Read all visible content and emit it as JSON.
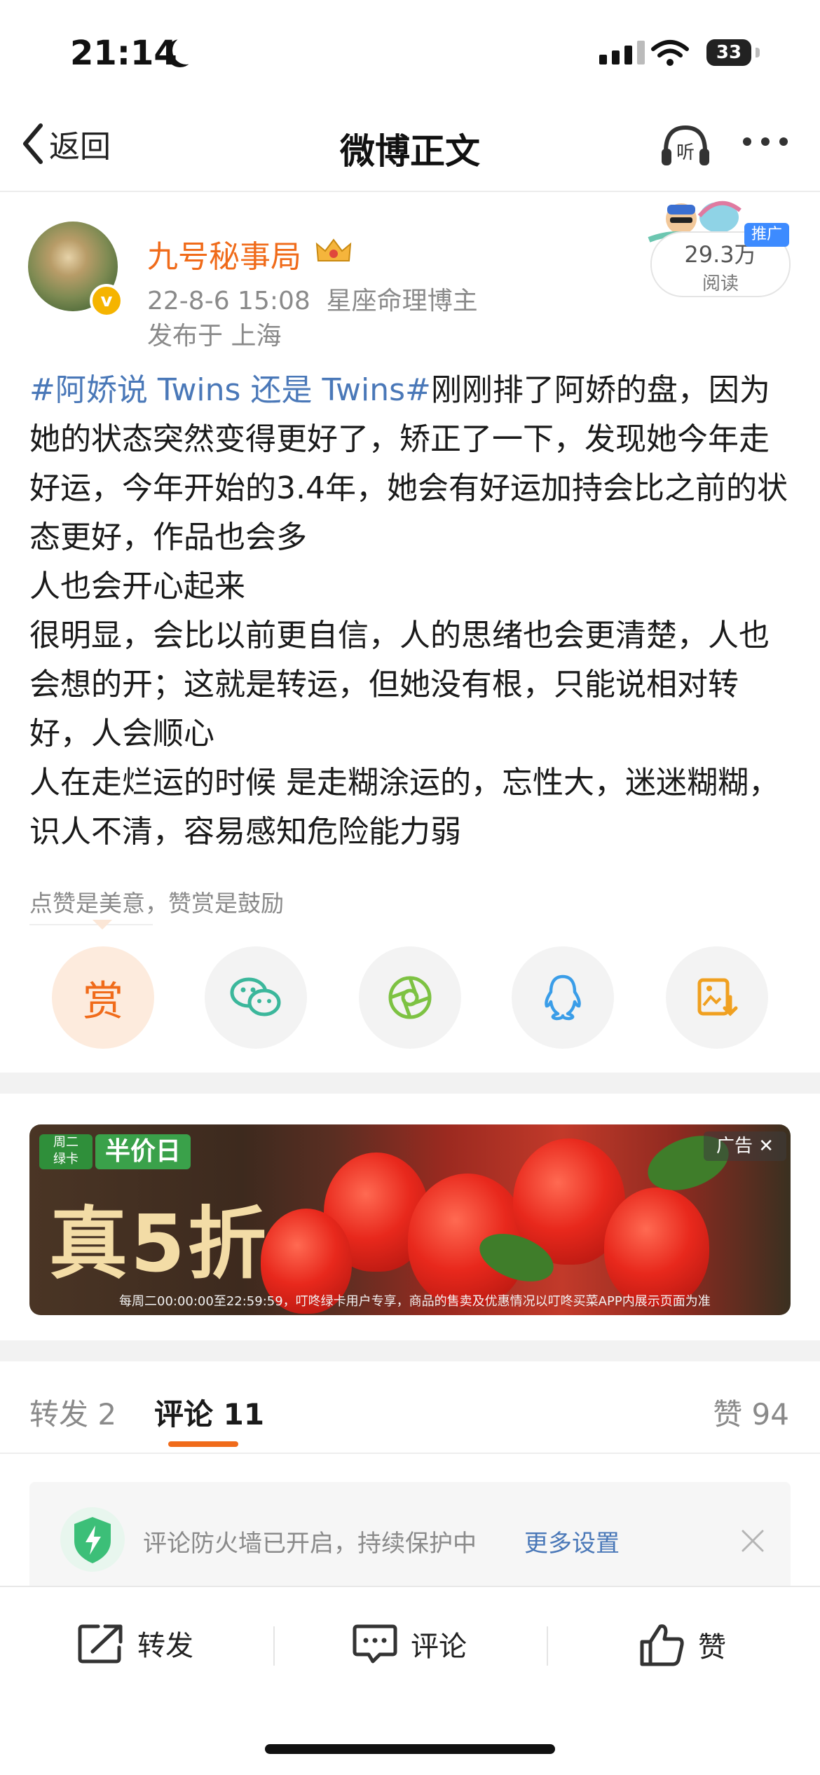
{
  "status_bar": {
    "time": "21:14",
    "battery": "33"
  },
  "nav": {
    "back_label": "返回",
    "title": "微博正文",
    "listen_label": "听"
  },
  "post": {
    "author": "九号秘事局",
    "meta": "22-8-6 15:08  星座命理博主",
    "location": "发布于 上海",
    "read_count": "29.3万",
    "read_label": "阅读",
    "promo_badge": "推广",
    "topic": "#阿娇说 Twins 还是 Twins#",
    "paragraphs": [
      "刚刚排了阿娇的盘，因为她的状态突然变得更好了，矫正了一下，发现她今年走好运，今年开始的3.4年，她会有好运加持会比之前的状态更好，作品也会多",
      "人也会开心起来",
      "很明显，会比以前更自信，人的思绪也会更清楚，人也会想的开；这就是转运，但她没有根，只能说相对转好，人会顺心",
      "人在走烂运的时候 是走糊涂运的，忘性大，迷迷糊糊，识人不清，容易感知危险能力弱"
    ],
    "reward_hint": "点赞是美意，赞赏是鼓励",
    "reward_label": "赏"
  },
  "ad": {
    "tag1": "周二\n绿卡",
    "tag2": "半价日",
    "headline": "真5折",
    "fine_print": "每周二00:00:00至22:59:59，叮咚绿卡用户专享，商品的售卖及优惠情况以叮咚买菜APP内展示页面为准",
    "label": "广告 ✕"
  },
  "tabs": {
    "repost": "转发 2",
    "comment": "评论 11",
    "like": "赞 94"
  },
  "firewall": {
    "text": "评论防火墙已开启，持续保护中",
    "link": "更多设置"
  },
  "bottom_bar": {
    "repost": "转发",
    "comment": "评论",
    "like": "赞"
  },
  "colors": {
    "accent": "#f06b1a",
    "link": "#4a78b8",
    "muted": "#8a8a8a"
  }
}
